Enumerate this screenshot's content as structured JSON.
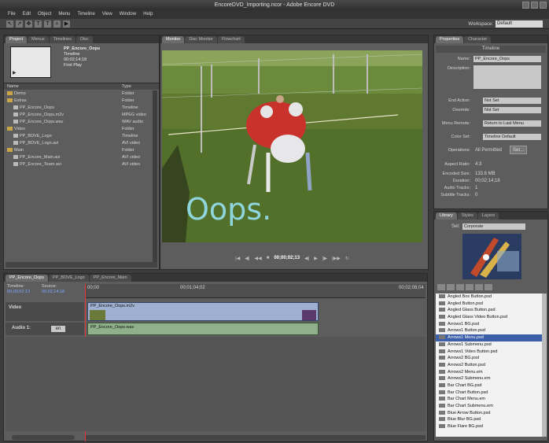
{
  "window": {
    "title": "EncoreDVD_Importing.ncor - Adobe Encore DVD"
  },
  "menu": [
    "File",
    "Edit",
    "Object",
    "Menu",
    "Timeline",
    "View",
    "Window",
    "Help"
  ],
  "workspace": {
    "label": "Workspace:",
    "value": "Default"
  },
  "project": {
    "tabs": [
      "Project",
      "Menus",
      "Timelines",
      "Disc"
    ],
    "preview": {
      "name": "PP_Encore_Oops",
      "type": "Timeline",
      "duration": "00;02;14;18",
      "note": "First Play"
    },
    "columns": {
      "name": "Name",
      "type": "Type"
    },
    "items": [
      {
        "name": "Demo",
        "type": "Folder",
        "kind": "folder",
        "indent": 0
      },
      {
        "name": "Extras",
        "type": "Folder",
        "kind": "folder",
        "indent": 0
      },
      {
        "name": "PP_Encore_Oops",
        "type": "Timeline",
        "kind": "file",
        "indent": 1
      },
      {
        "name": "PP_Encore_Oops.m2v",
        "type": "MPEG video",
        "kind": "file",
        "indent": 1
      },
      {
        "name": "PP_Encore_Oops.wav",
        "type": "WAV audio",
        "kind": "file",
        "indent": 1
      },
      {
        "name": "Video",
        "type": "Folder",
        "kind": "folder",
        "indent": 0
      },
      {
        "name": "PP_BDVE_Logo",
        "type": "Timeline",
        "kind": "file",
        "indent": 1
      },
      {
        "name": "PP_BDVE_Logo.avi",
        "type": "AVI video",
        "kind": "file",
        "indent": 1
      },
      {
        "name": "Main",
        "type": "Folder",
        "kind": "folder",
        "indent": 0
      },
      {
        "name": "PP_Encore_Main.avi",
        "type": "AVI video",
        "kind": "file",
        "indent": 1
      },
      {
        "name": "PP_Encore_Team.avi",
        "type": "AVI video",
        "kind": "file",
        "indent": 1
      }
    ]
  },
  "monitor": {
    "tabs": [
      "Monitor",
      "Disc Monitor",
      "Flowchart"
    ],
    "overlay_text": "Oops.",
    "timecode": "00;00;02;13"
  },
  "properties": {
    "tabs": [
      "Properties",
      "Character"
    ],
    "heading": "Timeline",
    "name_label": "Name:",
    "name_value": "PP_Encore_Oops",
    "desc_label": "Description:",
    "end_action_label": "End Action:",
    "end_action": "Not Set",
    "override_label": "Override:",
    "override": "Not Set",
    "menu_remote_label": "Menu Remote:",
    "menu_remote": "Return to Last Menu",
    "color_set_label": "Color Set:",
    "color_set": "Timeline Default",
    "operations_label": "Operations:",
    "operations": "All Permitted",
    "set_label": "Set...",
    "aspect_label": "Aspect Ratio:",
    "aspect": "4:3",
    "size_label": "Encoded Size:",
    "size": "133.6 MB",
    "duration_label": "Duration:",
    "duration": "00;02;14;18",
    "audio_label": "Audio Tracks:",
    "audio": "1",
    "subtitle_label": "Subtitle Tracks:",
    "subtitle": "0"
  },
  "library": {
    "tabs": [
      "Library",
      "Styles",
      "Layers"
    ],
    "set_label": "Set:",
    "set_value": "Corporate",
    "items": [
      {
        "name": "Angled Box Button.psd",
        "icon": "button",
        "selected": false
      },
      {
        "name": "Angled Button.psd",
        "icon": "button",
        "selected": false
      },
      {
        "name": "Angled Glass Button.psd",
        "icon": "button",
        "selected": false
      },
      {
        "name": "Angled Glass Video Button.psd",
        "icon": "button",
        "selected": false
      },
      {
        "name": "Arrows1 BG.psd",
        "icon": "image",
        "selected": false
      },
      {
        "name": "Arrows1 Button.psd",
        "icon": "button",
        "selected": false
      },
      {
        "name": "Arrows1 Menu.psd",
        "icon": "menu",
        "selected": true
      },
      {
        "name": "Arrows1 Submenu.psd",
        "icon": "menu",
        "selected": false
      },
      {
        "name": "Arrows1 Video Button.psd",
        "icon": "button",
        "selected": false
      },
      {
        "name": "Arrows2 BG.psd",
        "icon": "image",
        "selected": false
      },
      {
        "name": "Arrows2 Button.psd",
        "icon": "button",
        "selected": false
      },
      {
        "name": "Arrows2 Menu.em",
        "icon": "menu",
        "selected": false
      },
      {
        "name": "Arrows2 Submenu.em",
        "icon": "menu",
        "selected": false
      },
      {
        "name": "Bar Chart BG.psd",
        "icon": "image",
        "selected": false
      },
      {
        "name": "Bar Chart Button.psd",
        "icon": "button",
        "selected": false
      },
      {
        "name": "Bar Chart Menu.em",
        "icon": "menu",
        "selected": false
      },
      {
        "name": "Bar Chart Submenu.em",
        "icon": "menu",
        "selected": false
      },
      {
        "name": "Blue Arrow Button.psd",
        "icon": "button",
        "selected": false
      },
      {
        "name": "Blue Blur BG.psd",
        "icon": "image",
        "selected": false
      },
      {
        "name": "Blue Flare BG.psd",
        "icon": "image",
        "selected": false
      }
    ]
  },
  "timeline": {
    "tabs": [
      "PP_Encore_Oops",
      "PP_BDVE_Logo",
      "PP_Encore_Main"
    ],
    "timeline_label": "Timeline:",
    "timeline_tc": "00;00;02;13",
    "source_label": "Source:",
    "source_tc": "00;02;14;18",
    "ruler": [
      "00;00",
      "00;01;04;02",
      "00;02;08;04"
    ],
    "video_label": "Video",
    "video_clip": "PP_Encore_Oops.m2v",
    "audio_label": "Audio 1:",
    "audio_lang": "en",
    "audio_clip": "PP_Encore_Oops.wav"
  }
}
